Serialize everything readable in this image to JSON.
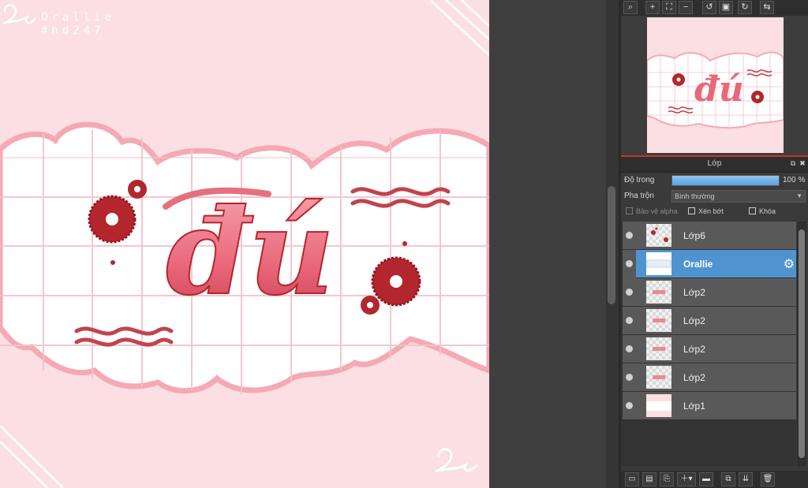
{
  "canvas": {
    "watermark_line1": "Orallie",
    "watermark_line2": "#hd247",
    "artwork_text": "đú",
    "background_color": "#fbdfe2",
    "accent_red": "#b3262d",
    "lettering_pink": "#ef7a88"
  },
  "navigator": {
    "thumb_text": "đú"
  },
  "nav_toolbar": {
    "buttons": [
      "zoom-fit-icon",
      "zoom-in-icon",
      "fit-window-icon",
      "zoom-out-icon",
      "rotate-left-icon",
      "actual-size-icon",
      "rotate-right-icon",
      "flip-icon"
    ]
  },
  "layer_panel": {
    "title": "Lớp",
    "opacity_label": "Độ trong",
    "opacity_value": "100 %",
    "opacity_percent": 100,
    "blend_label": "Pha trộn",
    "blend_value": "Bình thường",
    "protect_alpha_label": "Bảo vệ alpha",
    "clipping_label": "Xén bớt",
    "lock_label": "Khóa",
    "layers": [
      {
        "name": "Lớp6",
        "selected": false
      },
      {
        "name": "Orallie",
        "selected": true
      },
      {
        "name": "Lớp2",
        "selected": false
      },
      {
        "name": "Lớp2",
        "selected": false
      },
      {
        "name": "Lớp2",
        "selected": false
      },
      {
        "name": "Lớp2",
        "selected": false
      },
      {
        "name": "Lớp1",
        "selected": false
      }
    ],
    "selected_color": "#4f94d0"
  },
  "bottom_toolbar": {
    "buttons": [
      "new-layer-icon",
      "new-layer-alt-icon",
      "new-layer-copy-icon",
      "add-layer-menu-icon",
      "new-folder-icon",
      "duplicate-layer-icon",
      "merge-layer-icon",
      "delete-layer-icon"
    ]
  }
}
